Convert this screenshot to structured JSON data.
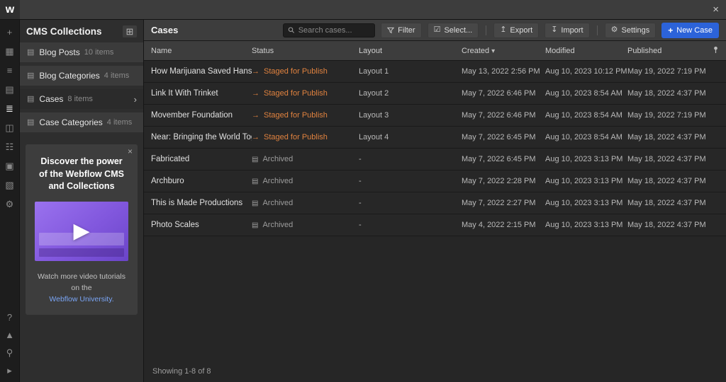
{
  "colors": {
    "accent_blue": "#2c63d9",
    "staged_orange": "#e0823f",
    "link_blue": "#7aa5f5",
    "promo_purple": "#8a63e0"
  },
  "icons": {
    "logo": "w",
    "close": "×",
    "promo_close": "×",
    "collection": "▤",
    "collection_manage": "⊞",
    "chevron_right": "›",
    "sort_caret": "▾",
    "staged_arrow": "→",
    "archived_box": "▤",
    "play": "▶",
    "select_checkbox": "☑",
    "export_arrow": "↥",
    "import_arrow": "↧",
    "settings_gear": "⚙",
    "new_case_plus": "+"
  },
  "rail": {
    "top": [
      {
        "name": "add-icon",
        "glyph": "+",
        "active": false
      },
      {
        "name": "elements-icon",
        "glyph": "▦",
        "active": false
      },
      {
        "name": "navigator-icon",
        "glyph": "≡",
        "active": false
      },
      {
        "name": "pages-icon",
        "glyph": "▤",
        "active": false
      },
      {
        "name": "cms-icon",
        "glyph": "≣",
        "active": true
      },
      {
        "name": "apps-icon",
        "glyph": "◫",
        "active": false
      },
      {
        "name": "users-icon",
        "glyph": "☷",
        "active": false
      },
      {
        "name": "ecommerce-icon",
        "glyph": "▣",
        "active": false
      },
      {
        "name": "assets-icon",
        "glyph": "▧",
        "active": false
      },
      {
        "name": "settings-icon",
        "glyph": "⚙",
        "active": false
      }
    ],
    "bottom": [
      {
        "name": "help-icon",
        "glyph": "?",
        "active": false
      },
      {
        "name": "canvas-icon",
        "glyph": "▲",
        "active": false
      },
      {
        "name": "search-icon",
        "glyph": "⚲",
        "active": false
      },
      {
        "name": "video-tutorials-icon",
        "glyph": "▸",
        "active": false
      }
    ]
  },
  "sidebar": {
    "title": "CMS Collections",
    "collections": [
      {
        "label": "Blog Posts",
        "count": "10 items",
        "selected": false
      },
      {
        "label": "Blog Categories",
        "count": "4 items",
        "selected": false
      },
      {
        "label": "Cases",
        "count": "8 items",
        "selected": true
      },
      {
        "label": "Case Categories",
        "count": "4 items",
        "selected": false
      }
    ],
    "promo": {
      "title": "Discover the power of the Webflow CMS and Collections",
      "caption": "Watch more video tutorials on the",
      "link": "Webflow University."
    }
  },
  "header": {
    "title": "Cases",
    "search_placeholder": "Search cases...",
    "filter": "Filter",
    "select": "Select...",
    "export": "Export",
    "import": "Import",
    "settings": "Settings",
    "new_case": "New Case"
  },
  "table": {
    "columns": [
      "Name",
      "Status",
      "Layout",
      "Created",
      "Modified",
      "Published"
    ],
    "sorted_column": "Created",
    "rows": [
      {
        "name": "How Marijuana Saved Hansel a...",
        "status": "Staged for Publish",
        "staged": true,
        "layout": "Layout 1",
        "created": "May 13, 2022 2:56 PM",
        "modified": "Aug 10, 2023 10:12 PM",
        "published": "May 19, 2022 7:19 PM"
      },
      {
        "name": "Link It With Trinket",
        "status": "Staged for Publish",
        "staged": true,
        "layout": "Layout 2",
        "created": "May 7, 2022 6:46 PM",
        "modified": "Aug 10, 2023 8:54 AM",
        "published": "May 18, 2022 4:37 PM"
      },
      {
        "name": "Movember Foundation",
        "status": "Staged for Publish",
        "staged": true,
        "layout": "Layout 3",
        "created": "May 7, 2022 6:46 PM",
        "modified": "Aug 10, 2023 8:54 AM",
        "published": "May 19, 2022 7:19 PM"
      },
      {
        "name": "Near: Bringing the World Toget...",
        "status": "Staged for Publish",
        "staged": true,
        "layout": "Layout 4",
        "created": "May 7, 2022 6:45 PM",
        "modified": "Aug 10, 2023 8:54 AM",
        "published": "May 18, 2022 4:37 PM"
      },
      {
        "name": "Fabricated",
        "status": "Archived",
        "staged": false,
        "layout": "-",
        "created": "May 7, 2022 6:45 PM",
        "modified": "Aug 10, 2023 3:13 PM",
        "published": "May 18, 2022 4:37 PM"
      },
      {
        "name": "Archburo",
        "status": "Archived",
        "staged": false,
        "layout": "-",
        "created": "May 7, 2022 2:28 PM",
        "modified": "Aug 10, 2023 3:13 PM",
        "published": "May 18, 2022 4:37 PM"
      },
      {
        "name": "This is Made Productions",
        "status": "Archived",
        "staged": false,
        "layout": "-",
        "created": "May 7, 2022 2:27 PM",
        "modified": "Aug 10, 2023 3:13 PM",
        "published": "May 18, 2022 4:37 PM"
      },
      {
        "name": "Photo Scales",
        "status": "Archived",
        "staged": false,
        "layout": "-",
        "created": "May 4, 2022 2:15 PM",
        "modified": "Aug 10, 2023 3:13 PM",
        "published": "May 18, 2022 4:37 PM"
      }
    ],
    "footer": "Showing 1-8 of 8"
  }
}
